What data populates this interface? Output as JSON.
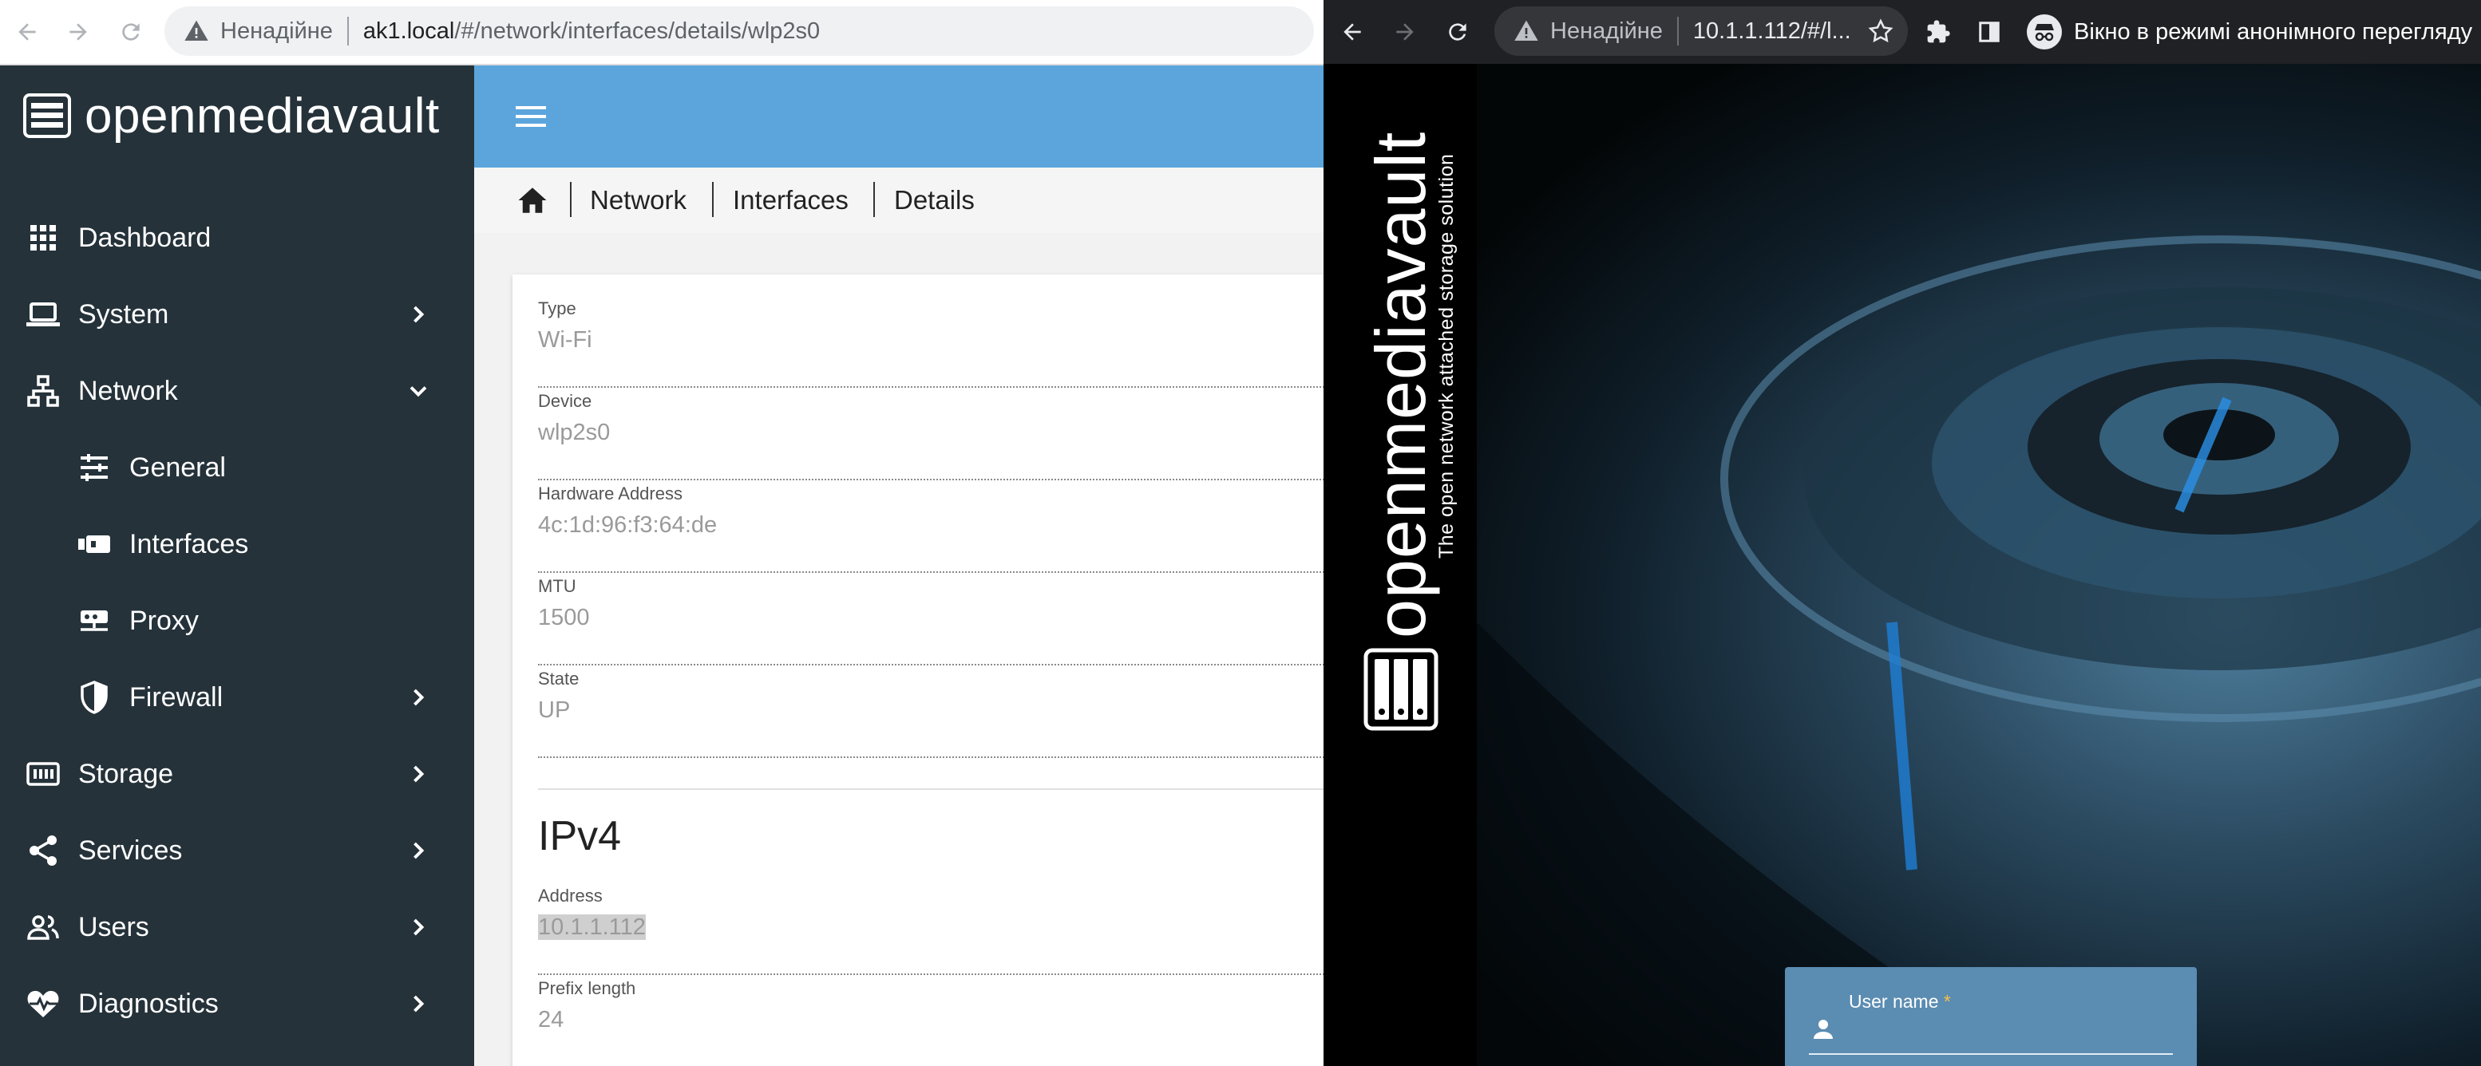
{
  "left_window": {
    "address_bar": {
      "security": "Ненадійне",
      "url_host": "ak1.local",
      "url_path": "/#/network/interfaces/details/wlp2s0"
    },
    "app_name": "openmediavault",
    "sidebar": {
      "items": [
        {
          "label": "Dashboard",
          "icon": "dashboard-grid-icon"
        },
        {
          "label": "System",
          "icon": "laptop-icon"
        },
        {
          "label": "Network",
          "icon": "network-icon"
        },
        {
          "label": "General",
          "icon": "sliders-icon"
        },
        {
          "label": "Interfaces",
          "icon": "ethernet-port-icon"
        },
        {
          "label": "Proxy",
          "icon": "proxy-icon"
        },
        {
          "label": "Firewall",
          "icon": "shield-icon"
        },
        {
          "label": "Storage",
          "icon": "storage-icon"
        },
        {
          "label": "Services",
          "icon": "share-icon"
        },
        {
          "label": "Users",
          "icon": "users-icon"
        },
        {
          "label": "Diagnostics",
          "icon": "heartbeat-icon"
        }
      ]
    },
    "breadcrumb": [
      "Network",
      "Interfaces",
      "Details"
    ],
    "details": {
      "fields": [
        {
          "label": "Type",
          "value": "Wi-Fi"
        },
        {
          "label": "Device",
          "value": "wlp2s0"
        },
        {
          "label": "Hardware Address",
          "value": "4c:1d:96:f3:64:de"
        },
        {
          "label": "MTU",
          "value": "1500"
        },
        {
          "label": "State",
          "value": "UP"
        }
      ],
      "ipv4_title": "IPv4",
      "ipv4_fields": [
        {
          "label": "Address",
          "value": "10.1.1.112"
        },
        {
          "label": "Prefix length",
          "value": "24"
        }
      ]
    },
    "colors": {
      "sidebar": "#25323a",
      "topbar": "#5ba5dc"
    }
  },
  "right_window": {
    "address_bar": {
      "security": "Ненадійне",
      "url": "10.1.1.112/#/l..."
    },
    "incognito_label": "Вікно в режимі анонімного перегляду",
    "brand": "openmediavault",
    "tagline": "The open network attached storage solution",
    "login": {
      "username_label": "User name",
      "required_mark": "*"
    }
  }
}
